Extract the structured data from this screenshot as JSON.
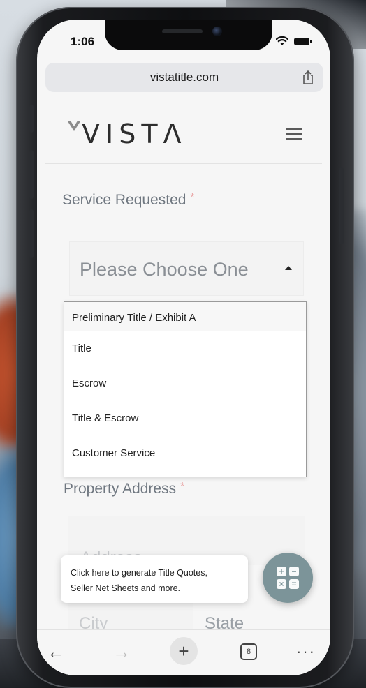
{
  "status": {
    "time": "1:06"
  },
  "browser": {
    "url": "vistatitle.com",
    "tab_count": "8"
  },
  "site": {
    "logo_text": "VISTΛ"
  },
  "form": {
    "service_label": "Service Requested",
    "required_marker": "*",
    "select_value": "Please Choose One",
    "options": [
      "Preliminary Title / Exhibit A",
      "Title",
      "Escrow",
      "Title & Escrow",
      "Customer Service"
    ],
    "property_label": "Property Address",
    "address_placeholder": "Address",
    "city_placeholder": "City",
    "state_placeholder": "State"
  },
  "tooltip": {
    "line1": "Click here to generate Title Quotes,",
    "line2": "Seller Net Sheets and more."
  },
  "toolbar": {
    "back": "←",
    "forward": "→",
    "new_tab": "+",
    "more": "···"
  },
  "icons": {
    "wifi": "wifi-icon",
    "battery": "battery-icon",
    "share": "share-icon",
    "menu": "hamburger-menu-icon",
    "calculator": "calculator-icon"
  }
}
